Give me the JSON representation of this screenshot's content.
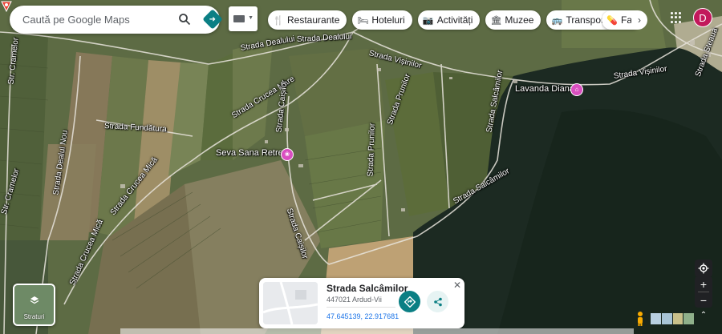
{
  "search": {
    "placeholder": "Caută pe Google Maps"
  },
  "chips": [
    {
      "label": "Restaurante",
      "icon": "fork-knife-icon"
    },
    {
      "label": "Hoteluri",
      "icon": "bed-icon"
    },
    {
      "label": "Activități",
      "icon": "camera-icon"
    },
    {
      "label": "Muzee",
      "icon": "museum-icon"
    },
    {
      "label": "Transport public",
      "icon": "bus-icon"
    },
    {
      "label": "Farm",
      "icon": "pharmacy-icon"
    }
  ],
  "account": {
    "initial": "D",
    "color": "#c2185b"
  },
  "roads": [
    "Strada Dealului",
    "Strada Dealului",
    "Strada Vișinilor",
    "Strada Vișinilor",
    "Str. Cramelor",
    "Strada Crucea Mare",
    "Strada Caișilor",
    "Strada Prunilor",
    "Strada Salcâmilor",
    "Strada Fundătura",
    "Strada Dealul Nou",
    "Str. Cramelor",
    "Strada Crucea Mică",
    "Strada Crucea Mică",
    "Strada Caișilor",
    "Strada Prunilor",
    "Strada Salcâmilor",
    "Strada Steaua"
  ],
  "pois": [
    {
      "name": "Seva Sana Retreat",
      "icon": "spa-icon"
    },
    {
      "name": "Lavanda Diana",
      "icon": "shop-icon"
    }
  ],
  "info_card": {
    "title": "Strada Salcâmilor",
    "address": "447021 Ardud-Vii",
    "coordinates": "47.645139, 22.917681"
  },
  "layers": {
    "label": "Straturi"
  },
  "colors": {
    "accent": "#0b7f84",
    "poi": "#d94fc0",
    "marker": "#ea4335"
  }
}
